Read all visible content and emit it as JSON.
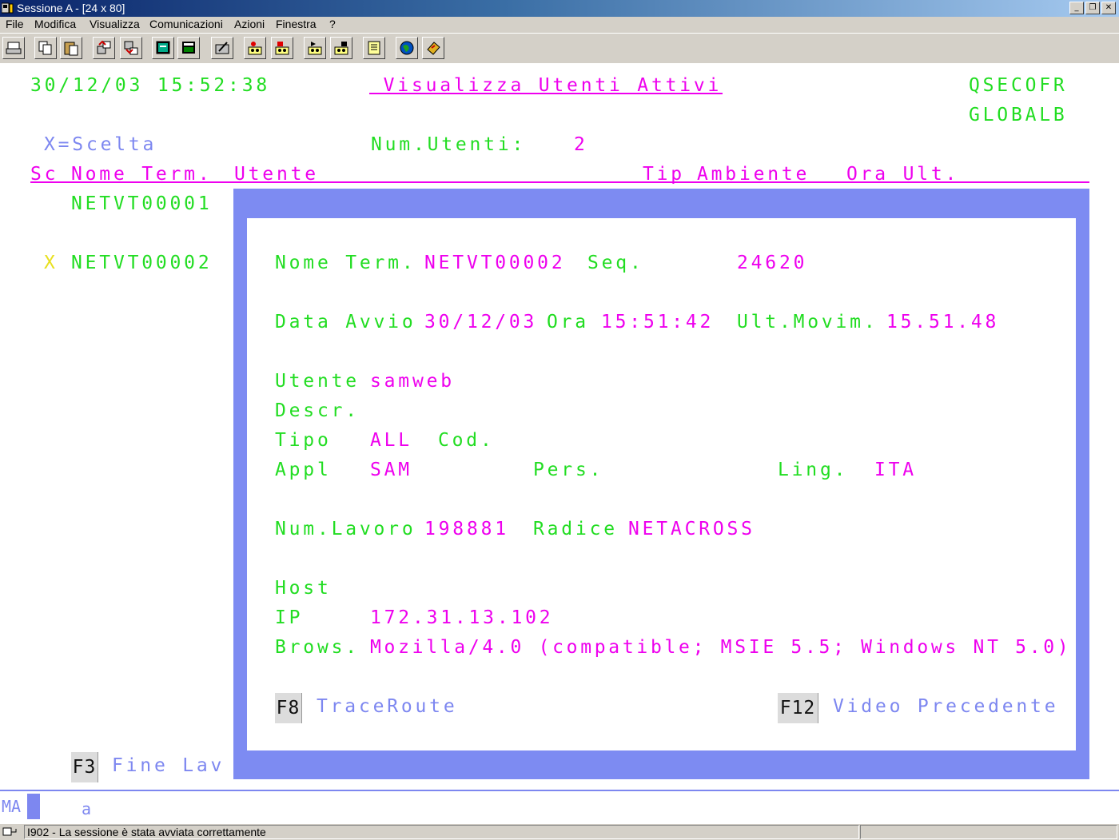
{
  "window": {
    "title": "Sessione A - [24 x 80]"
  },
  "menu": [
    "File",
    "Modifica",
    "Visualizza",
    "Comunicazioni",
    "Azioni",
    "Finestra",
    "?"
  ],
  "toolbar": {
    "icons": [
      "print-screen-icon",
      "copy-icon",
      "paste-icon",
      "send-file-icon",
      "receive-file-icon",
      "display-icon",
      "display-alt-icon",
      "edit-icon",
      "macro-record-icon",
      "macro-stop-icon",
      "macro-play-icon",
      "macro-pause-icon",
      "clipboard-icon",
      "web-icon",
      "help-book-icon"
    ]
  },
  "screen": {
    "datetime": "30/12/03 15:52:38",
    "title": " Visualizza Utenti Attivi ",
    "user": "QSECOFR",
    "system": "GLOBALB",
    "selection_hint": "X=Scelta",
    "num_users_label": "Num.Utenti:",
    "num_users_value": "2",
    "columns": {
      "sc": "Sc",
      "terminal": "Nome Term.",
      "user": "Utente",
      "type": "Tip",
      "environment": "Ambiente",
      "last_time": "Ora Ult."
    },
    "rows": [
      {
        "selection": "",
        "terminal": "NETVT00001"
      },
      {
        "selection": "X",
        "terminal": "NETVT00002"
      }
    ],
    "fkey_exit": {
      "key": "F3",
      "label": "Fine Lav"
    }
  },
  "popup": {
    "terminal_label": "Nome Term.",
    "terminal_value": "NETVT00002",
    "seq_label": "Seq.",
    "seq_value": "24620",
    "start_date_label": "Data Avvio",
    "start_date_value": "30/12/03",
    "time_label": "Ora",
    "time_value": "15:51:42",
    "last_move_label": "Ult.Movim.",
    "last_move_value": "15.51.48",
    "user_label": "Utente",
    "user_value": "samweb",
    "descr_label": "Descr.",
    "type_label": "Tipo",
    "type_value": "ALL",
    "code_label": "Cod.",
    "appl_label": "Appl",
    "appl_value": "SAM",
    "pers_label": "Pers.",
    "lang_label": "Ling.",
    "lang_value": "ITA",
    "job_label": "Num.Lavoro",
    "job_value": "198881",
    "root_label": "Radice",
    "root_value": "NETACROSS",
    "host_label": "Host",
    "ip_label": "IP",
    "ip_value": "172.31.13.102",
    "browser_label": "Brows.",
    "browser_value": "Mozilla/4.0 (compatible; MSIE 5.5; Windows NT 5.0)",
    "fkey_trace": {
      "key": "F8",
      "label": "TraceRoute"
    },
    "fkey_back": {
      "key": "F12",
      "label": "Video Precedente"
    }
  },
  "oia": {
    "mode": "MA",
    "indicator": "a"
  },
  "status": {
    "message": "I902 - La sessione è stata avviata correttamente"
  },
  "colors": {
    "field_green": "#22dd22",
    "field_magenta": "#ee00ee",
    "field_blue": "#7d87f0",
    "field_yellow": "#e8e020",
    "popup_border": "#7d8bf2"
  }
}
